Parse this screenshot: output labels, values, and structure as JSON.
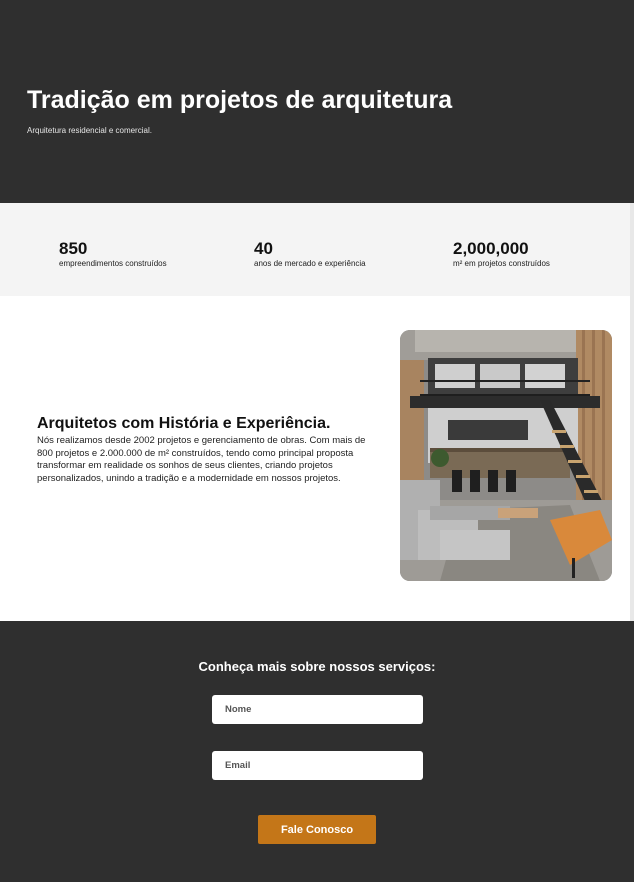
{
  "hero": {
    "title": "Tradição em projetos de arquitetura",
    "subtitle": "Arquitetura residencial e comercial."
  },
  "stats": [
    {
      "value": "850",
      "label": "empreendimentos construídos"
    },
    {
      "value": "40",
      "label": "anos de mercado e experiência"
    },
    {
      "value": "2,000,000",
      "label": "m² em projetos construídos"
    }
  ],
  "about": {
    "title": "Arquitetos com História e Experiência.",
    "text": "Nós realizamos desde 2002 projetos e gerenciamento de obras. Com mais de 800 projetos e 2.000.000 de m² construídos, tendo como principal proposta transformar em realidade os sonhos de seus clientes, criando projetos personalizados, unindo a tradição e a modernidade em nossos projetos.",
    "image_icon": "loft-interior-photo"
  },
  "contact": {
    "heading": "Conheça mais sobre nossos serviços:",
    "name_placeholder": "Nome",
    "email_placeholder": "Email",
    "submit_label": "Fale Conosco"
  },
  "colors": {
    "dark_bg": "#2f2f2f",
    "stats_bg": "#f4f4f4",
    "accent": "#c47618"
  }
}
